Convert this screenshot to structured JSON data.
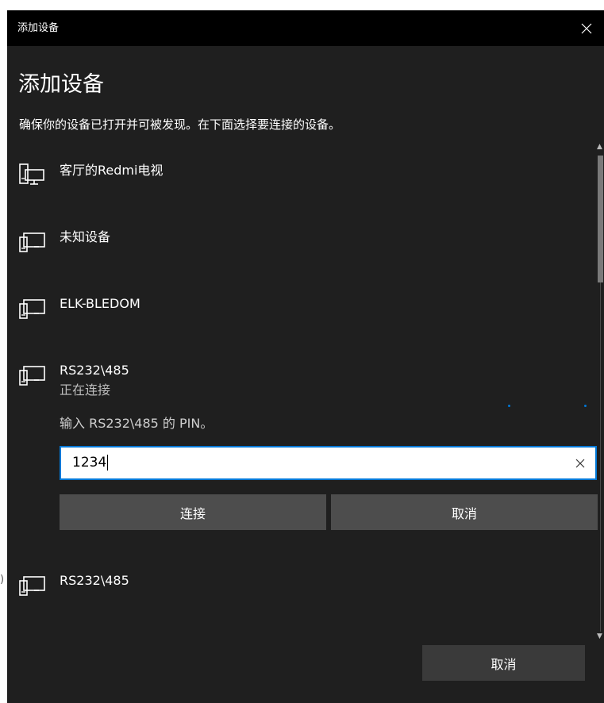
{
  "window": {
    "title": "添加设备"
  },
  "heading": "添加设备",
  "subtitle": "确保你的设备已打开并可被发现。在下面选择要连接的设备。",
  "devices": [
    {
      "name": "客厅的Redmi电视",
      "icon": "monitor-device-icon"
    },
    {
      "name": "未知设备",
      "icon": "generic-device-icon"
    },
    {
      "name": "ELK-BLEDOM",
      "icon": "generic-device-icon"
    },
    {
      "name": "RS232\\485",
      "status": "正在连接",
      "icon": "generic-device-icon"
    },
    {
      "name": "RS232\\485",
      "icon": "generic-device-icon"
    }
  ],
  "pin": {
    "prompt": "输入 RS232\\485 的 PIN。",
    "value": "1234",
    "connect_label": "连接",
    "cancel_label": "取消"
  },
  "footer": {
    "cancel_label": "取消"
  },
  "edge_glyph": ")",
  "colors": {
    "accent": "#0078d7",
    "background": "#1f1f1f",
    "titlebar": "#000000",
    "button": "#4d4d4d"
  }
}
